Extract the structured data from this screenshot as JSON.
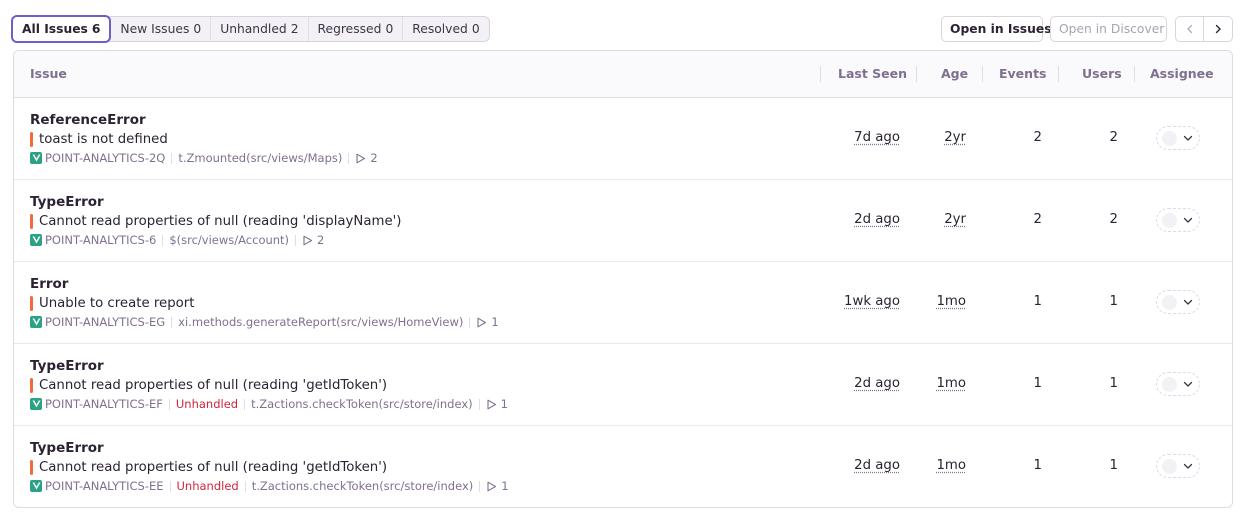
{
  "filters": [
    {
      "label": "All Issues",
      "count": "6",
      "active": true
    },
    {
      "label": "New Issues",
      "count": "0"
    },
    {
      "label": "Unhandled",
      "count": "2"
    },
    {
      "label": "Regressed",
      "count": "0"
    },
    {
      "label": "Resolved",
      "count": "0"
    }
  ],
  "actions": {
    "open_in_issues": "Open in Issues",
    "open_in_discover": "Open in Discover",
    "prev_icon": "chevron-left-icon",
    "next_icon": "chevron-right-icon"
  },
  "table": {
    "columns": {
      "issue": "Issue",
      "last_seen": "Last Seen",
      "age": "Age",
      "events": "Events",
      "users": "Users",
      "assignee": "Assignee"
    },
    "rows": [
      {
        "type": "ReferenceError",
        "message": "toast is not defined",
        "short_id": "POINT-ANALYTICS-2Q",
        "unhandled": "",
        "culprit": "t.Zmounted(src/views/Maps)",
        "replays": "2",
        "last_seen": "7d ago",
        "age": "2yr",
        "events": "2",
        "users": "2"
      },
      {
        "type": "TypeError",
        "message": "Cannot read properties of null (reading 'displayName')",
        "short_id": "POINT-ANALYTICS-6",
        "unhandled": "",
        "culprit": "$(src/views/Account)",
        "replays": "2",
        "last_seen": "2d ago",
        "age": "2yr",
        "events": "2",
        "users": "2"
      },
      {
        "type": "Error",
        "message": "Unable to create report",
        "short_id": "POINT-ANALYTICS-EG",
        "unhandled": "",
        "culprit": "xi.methods.generateReport(src/views/HomeView)",
        "replays": "1",
        "last_seen": "1wk ago",
        "age": "1mo",
        "events": "1",
        "users": "1"
      },
      {
        "type": "TypeError",
        "message": "Cannot read properties of null (reading 'getIdToken')",
        "short_id": "POINT-ANALYTICS-EF",
        "unhandled": "Unhandled",
        "culprit": "t.Zactions.checkToken(src/store/index)",
        "replays": "1",
        "last_seen": "2d ago",
        "age": "1mo",
        "events": "1",
        "users": "1"
      },
      {
        "type": "TypeError",
        "message": "Cannot read properties of null (reading 'getIdToken')",
        "short_id": "POINT-ANALYTICS-EE",
        "unhandled": "Unhandled",
        "culprit": "t.Zactions.checkToken(src/store/index)",
        "replays": "1",
        "last_seen": "2d ago",
        "age": "1mo",
        "events": "1",
        "users": "1"
      }
    ]
  },
  "colors": {
    "accent": "#6c5fc7",
    "level_bar": "#f2693d",
    "platform_vue": "#2ba185",
    "unhandled": "#d0263c",
    "muted_text": "#80708f"
  }
}
